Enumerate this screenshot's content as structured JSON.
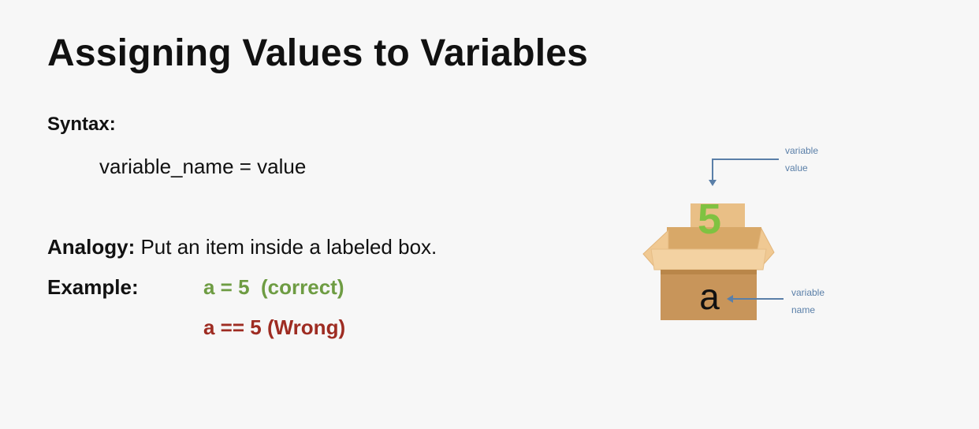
{
  "slide": {
    "title": "Assigning Values to Variables",
    "syntax_label": "Syntax:",
    "syntax_code": "variable_name = value",
    "analogy_label": "Analogy:",
    "analogy_text": " Put an item inside a labeled box.",
    "example_label": "Example:",
    "example_correct": "a = 5  (correct)",
    "example_wrong": "a == 5 (Wrong)"
  },
  "diagram": {
    "box_value": "5",
    "box_label": "a",
    "annotation_value_line1": "variable",
    "annotation_value_line2": "value",
    "annotation_name_line1": "variable",
    "annotation_name_line2": "name"
  },
  "colors": {
    "correct": "#6e9c43",
    "wrong": "#9e2c22",
    "number_five": "#7fc241",
    "annotation": "#5a7fa8",
    "box_front": "#c8955a",
    "box_flap": "#f0c993"
  }
}
